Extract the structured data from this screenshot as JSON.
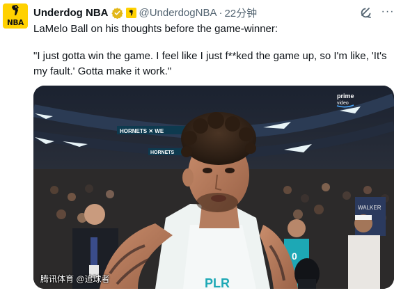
{
  "tweet": {
    "author_name": "Underdog NBA",
    "handle": "@UnderdogNBA",
    "separator": "·",
    "timestamp": "22分钟",
    "line1": "LaMelo Ball on his thoughts before the game-winner:",
    "quote": "\"I just gotta win the game. I feel like I just f**ked the game up, so I'm like, 'It's my fault.' Gotta make it work.\"",
    "avatar_text": "NBA"
  },
  "icons": {
    "avatar": "underdog-logo",
    "verified": "verified-badge-icon",
    "affiliate": "affiliate-logo-icon",
    "grok": "grok-icon",
    "more": "more-options-icon"
  },
  "media": {
    "arena_text_1": "HORNETS ✕ WE",
    "arena_text_2": "HORNETS",
    "broadcaster": "prime",
    "broadcaster_sub": "video",
    "jersey_name": "WALKER",
    "jersey_num": "0",
    "shirt_text": "PLR",
    "watermark": "腾讯体育 @追球者"
  },
  "colors": {
    "brand_yellow": "#ffd100",
    "verified_gold": "#e2b719",
    "teal": "#1da8b5",
    "text_primary": "#0f1419",
    "text_secondary": "#536471"
  }
}
